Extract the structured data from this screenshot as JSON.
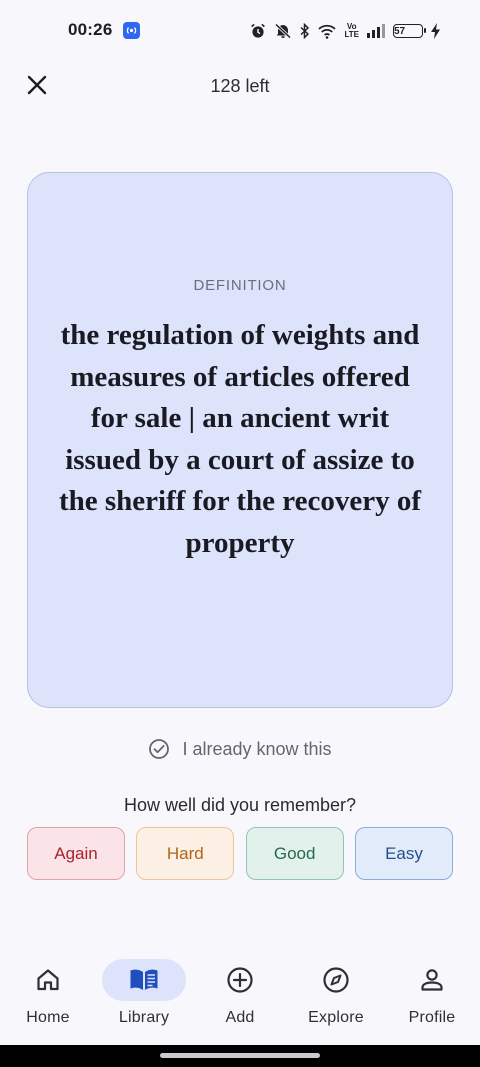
{
  "status_bar": {
    "time": "00:26",
    "battery": "57",
    "volte_top": "Vo",
    "volte_bottom": "LTE",
    "icons": [
      "alarm-icon",
      "mute-icon",
      "bluetooth-icon",
      "wifi-icon",
      "volte-icon",
      "signal-icon",
      "battery-icon",
      "charging-icon"
    ]
  },
  "header": {
    "remaining": "128 left",
    "close_icon": "close-icon"
  },
  "card": {
    "label": "DEFINITION",
    "text": "the regulation of weights and measures of articles offered for sale | an ancient writ issued by a court of assize to the sheriff for the recovery of property"
  },
  "know": {
    "label": "I already know this",
    "icon": "check-circle-icon"
  },
  "rating": {
    "question": "How well did you remember?",
    "buttons": [
      {
        "label": "Again",
        "color": "#A8232F"
      },
      {
        "label": "Hard",
        "color": "#B2651A"
      },
      {
        "label": "Good",
        "color": "#256A4C"
      },
      {
        "label": "Easy",
        "color": "#264D8F"
      }
    ]
  },
  "nav": {
    "active": "Library",
    "items": [
      {
        "label": "Home",
        "icon": "home-icon"
      },
      {
        "label": "Library",
        "icon": "book-icon"
      },
      {
        "label": "Add",
        "icon": "add-circle-icon"
      },
      {
        "label": "Explore",
        "icon": "compass-icon"
      },
      {
        "label": "Profile",
        "icon": "person-icon"
      }
    ]
  },
  "colors": {
    "background": "#F8F8FC",
    "card": "#DCE3FB",
    "accent": "#1F4FBF"
  }
}
